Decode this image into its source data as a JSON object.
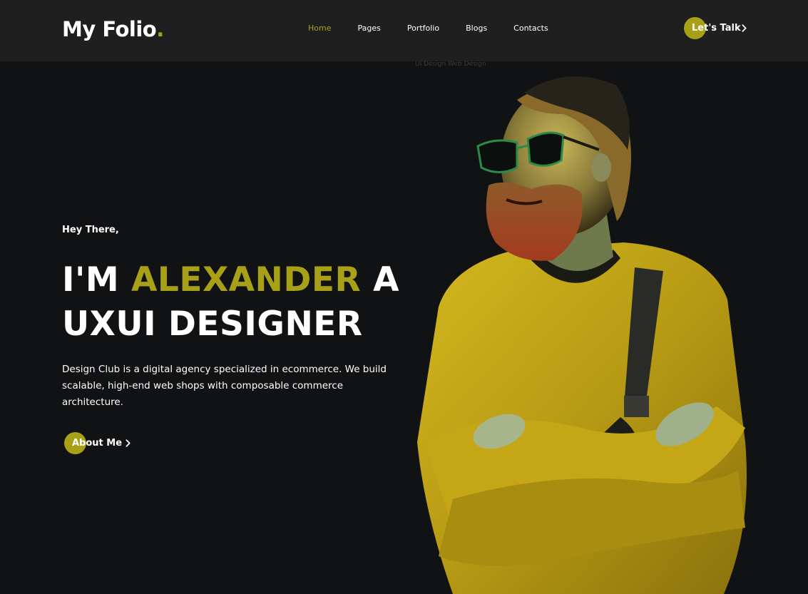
{
  "header": {
    "logo_main": "My Folio",
    "logo_dot": ".",
    "nav": [
      {
        "label": "Home",
        "active": true
      },
      {
        "label": "Pages",
        "active": false
      },
      {
        "label": "Portfolio",
        "active": false
      },
      {
        "label": "Blogs",
        "active": false
      },
      {
        "label": "Contacts",
        "active": false
      }
    ],
    "cta_label": "Let's Talk"
  },
  "tag_text": "UI Design  Web Design",
  "hero": {
    "greeting": "Hey There,",
    "line1_prefix": "I'M ",
    "line1_highlight": "ALEXANDER",
    "line1_suffix": " A",
    "line2": "UXUI DESIGNER",
    "description": "Design Club is a digital agency specialized in ecommerce. We build scalable, high-end web shops with composable commerce architecture.",
    "button_label": "About Me"
  },
  "colors": {
    "accent": "#a8a118",
    "background": "#111214",
    "header_bg": "#1f1f20"
  },
  "icons": {
    "cta_icon": "chevron-right-icon",
    "about_icon": "chevron-right-icon"
  }
}
